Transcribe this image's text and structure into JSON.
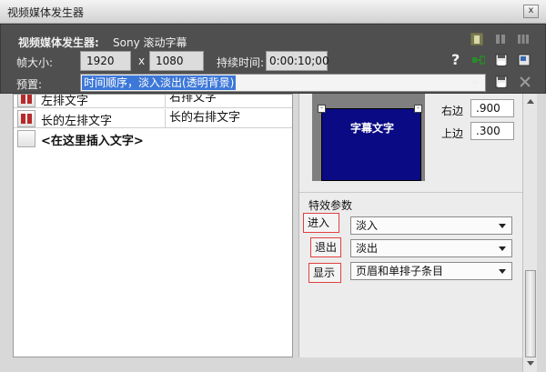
{
  "window": {
    "title": "视频媒体发生器",
    "close_glyph": "x"
  },
  "generator": {
    "label": "视频媒体发生器:",
    "name": "Sony 滚动字幕",
    "frame_size_label": "帧大小:",
    "width": "1920",
    "x_sep": "x",
    "height": "1080",
    "duration_label": "持续时间:",
    "duration": "0:00:10;00",
    "preset_label": "预置:",
    "preset_value": "时间顺序，淡入淡出(透明背景)",
    "help_glyph": "?"
  },
  "text_list": {
    "rows": [
      {
        "left": "左排文字",
        "right": "右排文字"
      },
      {
        "left": "长的左排文字",
        "right": "长的右排文字"
      }
    ],
    "insert_hint": "<在这里插入文字>"
  },
  "preview": {
    "caption": "字幕文字",
    "handle_glyph": "-"
  },
  "margins": {
    "right_label": "右边",
    "right_value": ".900",
    "top_label": "上边",
    "top_value": ".300"
  },
  "effects": {
    "header": "特效参数",
    "enter_label": "进入",
    "enter_value": "淡入",
    "exit_label": "退出",
    "exit_value": "淡出",
    "display_label": "显示",
    "display_value": "页眉和单排子条目"
  },
  "colors": {
    "preview_bg": "#0a0a84",
    "highlight": "#3d78d8",
    "effect_border": "#e24040"
  }
}
